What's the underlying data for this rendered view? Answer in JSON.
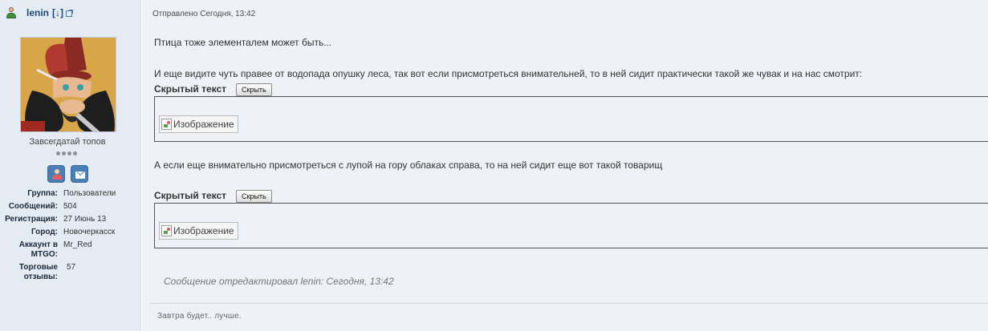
{
  "user": {
    "name": "lenin",
    "name_suffix": "[↓]",
    "rank": "Завсегдатай топов",
    "rank_pips": 4,
    "info": [
      {
        "label": "Группа:",
        "value": "Пользователи"
      },
      {
        "label": "Сообщений:",
        "value": "504"
      },
      {
        "label": "Регистрация:",
        "value": "27 Июнь 13"
      },
      {
        "label": "Город:",
        "value": "Новочеркасск"
      },
      {
        "label": "Аккаунт в MTGO:",
        "value": "Mr_Red"
      },
      {
        "label": "Торговые отзывы:",
        "value": "57"
      }
    ],
    "icons": {
      "user": "user-icon",
      "external": "external-link-icon",
      "profile": "profile-icon",
      "message": "envelope-icon"
    }
  },
  "post": {
    "date": "Отправлено Сегодня, 13:42",
    "paragraph1": "Птица тоже элементалем может быть...",
    "paragraph2": "И еще видите чуть правее от водопада опушку леса, так вот если присмотреться внимательней, то в ней сидит практически такой же чувак и на нас смотрит:",
    "paragraph3": "А если еще внимательно присмотреться с лупой на гору облаках справа, то на ней сидит еще вот такой товарищ",
    "spoilers": [
      {
        "label": "Скрытый текст",
        "button": "Скрыть",
        "image_alt": "Изображение"
      },
      {
        "label": "Скрытый текст",
        "button": "Скрыть",
        "image_alt": "Изображение"
      }
    ],
    "edit_note": "Сообщение отредактировал lenin: Сегодня, 13:42",
    "signature": "Завтра будет.. лучше."
  },
  "colors": {
    "sidebar_bg": "#e4ebf2",
    "post_bg": "#eef1f5",
    "username": "#1c4a7a",
    "button_blue": "#4a7fb5"
  }
}
